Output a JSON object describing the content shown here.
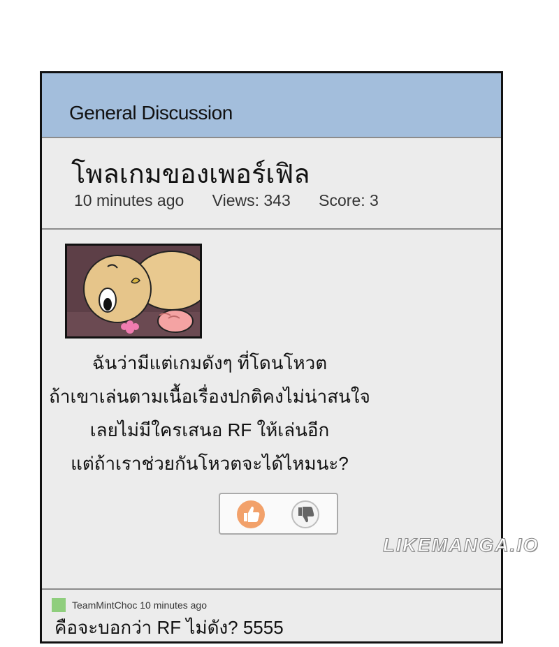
{
  "forum": {
    "section_title": "General Discussion"
  },
  "post": {
    "title": "โพลเกมของเพอร์เฟิล",
    "time": "10 minutes ago",
    "views": "Views: 343",
    "score": "Score: 3",
    "body_lines": [
      "ฉันว่ามีแต่เกมดังๆ ที่โดนโหวต",
      "ถ้าเขาเล่นตามเนื้อเรื่องปกติคงไม่น่าสนใจ",
      "เลยไม่มีใครเสนอ RF ให้เล่นอีก",
      "แต่ถ้าเราช่วยกันโหวตจะได้ไหมนะ?"
    ],
    "thumbnail_icon": "cartoon-character-image"
  },
  "votes": {
    "up_icon": "thumbs-up-icon",
    "down_icon": "thumbs-down-icon",
    "up_color": "#f2a16a"
  },
  "comment": {
    "author_time": "TeamMintChoc 10 minutes ago",
    "text": "คือจะบอกว่า RF ไม่ดัง? 5555",
    "avatar_color": "#8fce7d"
  },
  "watermark": "LIKEMANGA.IO"
}
